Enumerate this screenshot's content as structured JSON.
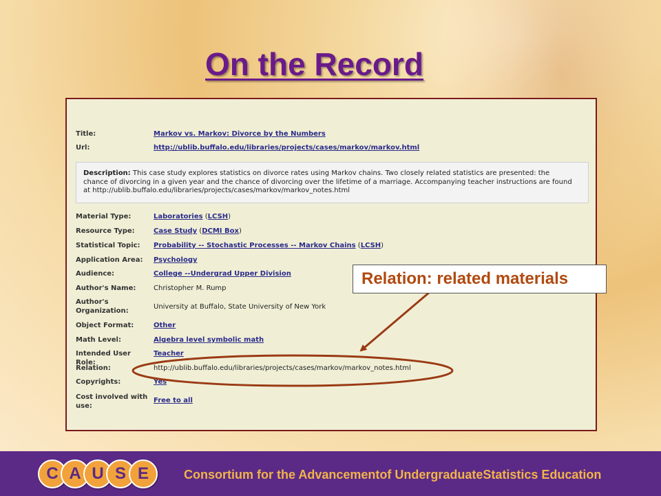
{
  "slide": {
    "title": "On the Record"
  },
  "record": {
    "title": {
      "label": "Title:",
      "link": "Markov vs. Markov: Divorce by the Numbers"
    },
    "url": {
      "label": "Url:",
      "link": "http://ublib.buffalo.edu/libraries/projects/cases/markov/markov.html"
    },
    "description": {
      "label": "Description:",
      "text": "This case study explores statistics on divorce rates using Markov chains. Two closely related statistics are presented: the chance of divorcing in a given year and the chance of divorcing over the lifetime of a marriage. Accompanying teacher instructions are found at http://ublib.buffalo.edu/libraries/projects/cases/markov/markov_notes.html"
    },
    "material_type": {
      "label": "Material Type:",
      "link": "Laboratories",
      "paren_link": "LCSH"
    },
    "resource_type": {
      "label": "Resource Type:",
      "link": "Case Study",
      "paren_link": "DCMI Box"
    },
    "statistical_topic": {
      "label": "Statistical Topic:",
      "link": "Probability -- Stochastic Processes -- Markov Chains",
      "paren_link": "LCSH"
    },
    "application_area": {
      "label": "Application Area:",
      "link": "Psychology"
    },
    "audience": {
      "label": "Audience:",
      "link": "College --Undergrad Upper Division"
    },
    "authors_name": {
      "label": "Author's Name:",
      "value": "Christopher M. Rump"
    },
    "authors_org": {
      "label_line1": "Author's",
      "label_line2": "Organization:",
      "value": "University at Buffalo, State University of New York"
    },
    "object_format": {
      "label": "Object Format:",
      "link": "Other"
    },
    "math_level": {
      "label": "Math Level:",
      "link": "Algebra level symbolic math"
    },
    "intended_user_role": {
      "label": "Intended User Role:",
      "link": "Teacher"
    },
    "relation": {
      "label": "Relation:",
      "value": "http://ublib.buffalo.edu/libraries/projects/cases/markov/markov_notes.html"
    },
    "copyrights": {
      "label": "Copyrights:",
      "link": "Yes"
    },
    "cost": {
      "label_line1": "Cost involved with",
      "label_line2": "use:",
      "link": "Free to all"
    }
  },
  "callout": {
    "text": "Relation: related materials"
  },
  "footer": {
    "logo_letters": [
      "C",
      "A",
      "U",
      "S",
      "E"
    ],
    "text": "Consortium for the Advancementof UndergraduateStatistics Education"
  },
  "colors": {
    "title": "#6a1a8a",
    "link": "#2a2a8a",
    "callout_text": "#b04a10",
    "annotation": "#9a3a14",
    "footer_bg": "#5b2a86",
    "footer_text": "#f2b34a"
  }
}
